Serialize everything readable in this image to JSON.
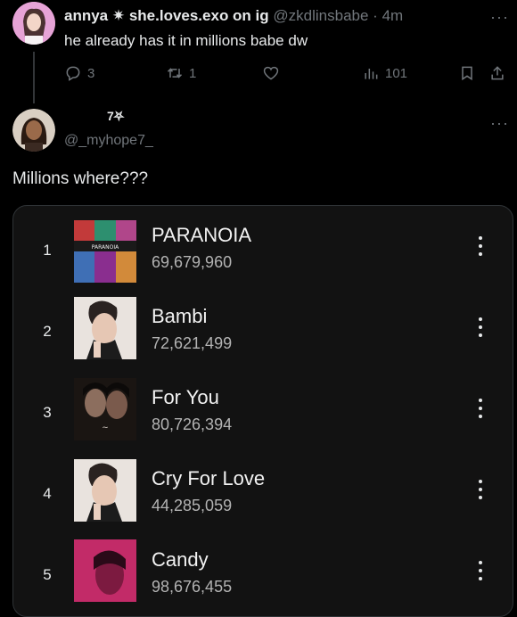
{
  "tweet1": {
    "display_name": "annya ✷ she.loves.exo on ig",
    "handle": "@zkdlinsbabe",
    "separator": "·",
    "time": "4m",
    "text": "he already has it in millions babe dw",
    "more_label": "···",
    "actions": {
      "reply_count": "3",
      "retweet_count": "1",
      "like_count": "",
      "views_count": "101"
    }
  },
  "tweet2": {
    "display_name": "7⛧",
    "handle": "@_myhope7_",
    "more_label": "···",
    "text": "Millions where???"
  },
  "tracks": [
    {
      "rank": "1",
      "title": "PARANOIA",
      "plays": "69,679,960",
      "art": "paranoia-album-art"
    },
    {
      "rank": "2",
      "title": "Bambi",
      "plays": "72,621,499",
      "art": "bambi-album-art"
    },
    {
      "rank": "3",
      "title": "For You",
      "plays": "80,726,394",
      "art": "for-you-album-art"
    },
    {
      "rank": "4",
      "title": "Cry For Love",
      "plays": "44,285,059",
      "art": "cry-for-love-album-art"
    },
    {
      "rank": "5",
      "title": "Candy",
      "plays": "98,676,455",
      "art": "candy-album-art"
    }
  ],
  "colors": {
    "background": "#000000",
    "text": "#e7e9ea",
    "muted": "#71767b",
    "card": "#121212"
  }
}
